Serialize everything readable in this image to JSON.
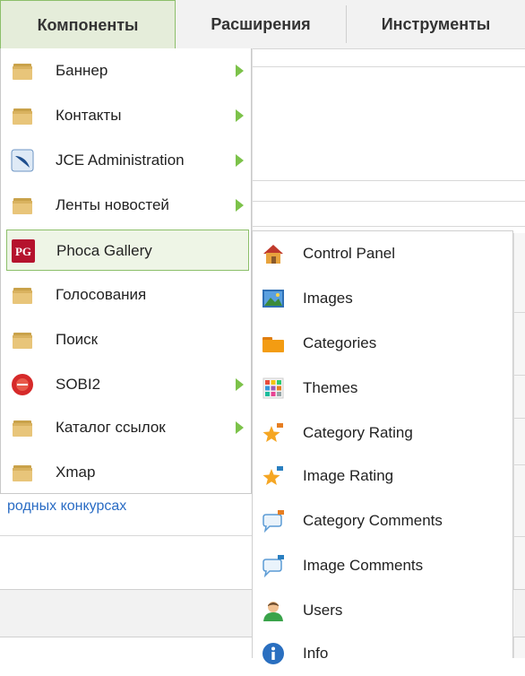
{
  "menubar": {
    "tabs": [
      {
        "label": "Компоненты",
        "active": true
      },
      {
        "label": "Расширения",
        "active": false
      },
      {
        "label": "Инструменты",
        "active": false
      }
    ]
  },
  "menu": {
    "items": [
      {
        "label": "Баннер",
        "icon": "folder-icon",
        "submenu": true
      },
      {
        "label": "Контакты",
        "icon": "folder-icon",
        "submenu": true
      },
      {
        "label": "JCE Administration",
        "icon": "jce-feather-icon",
        "submenu": true
      },
      {
        "label": "Ленты новостей",
        "icon": "folder-icon",
        "submenu": true
      },
      {
        "label": "Phoca Gallery",
        "icon": "pg-logo-icon",
        "submenu": false,
        "hover": true
      },
      {
        "label": "Голосования",
        "icon": "folder-icon",
        "submenu": false
      },
      {
        "label": "Поиск",
        "icon": "folder-icon",
        "submenu": false
      },
      {
        "label": "SOBI2",
        "icon": "sobi-icon",
        "submenu": true
      },
      {
        "label": "Каталог ссылок",
        "icon": "folder-icon",
        "submenu": true
      },
      {
        "label": "Xmap",
        "icon": "folder-icon",
        "submenu": false
      }
    ]
  },
  "submenu": {
    "items": [
      {
        "label": "Control Panel",
        "icon": "house-icon"
      },
      {
        "label": "Images",
        "icon": "picture-icon"
      },
      {
        "label": "Categories",
        "icon": "open-folder-icon"
      },
      {
        "label": "Themes",
        "icon": "palette-icon"
      },
      {
        "label": "Category Rating",
        "icon": "star-icon"
      },
      {
        "label": "Image Rating",
        "icon": "star-icon"
      },
      {
        "label": "Category Comments",
        "icon": "speech-bubble-icon"
      },
      {
        "label": "Image Comments",
        "icon": "speech-bubble-icon"
      },
      {
        "label": "Users",
        "icon": "user-icon"
      },
      {
        "label": "Info",
        "icon": "info-icon"
      }
    ]
  },
  "background": {
    "link_text": "родных конкурсах"
  },
  "colors": {
    "accent_green": "#8cbf6a",
    "hover_bg": "#eef5e6",
    "arrow_green": "#7cc24a",
    "link_blue": "#2a6cc4"
  }
}
